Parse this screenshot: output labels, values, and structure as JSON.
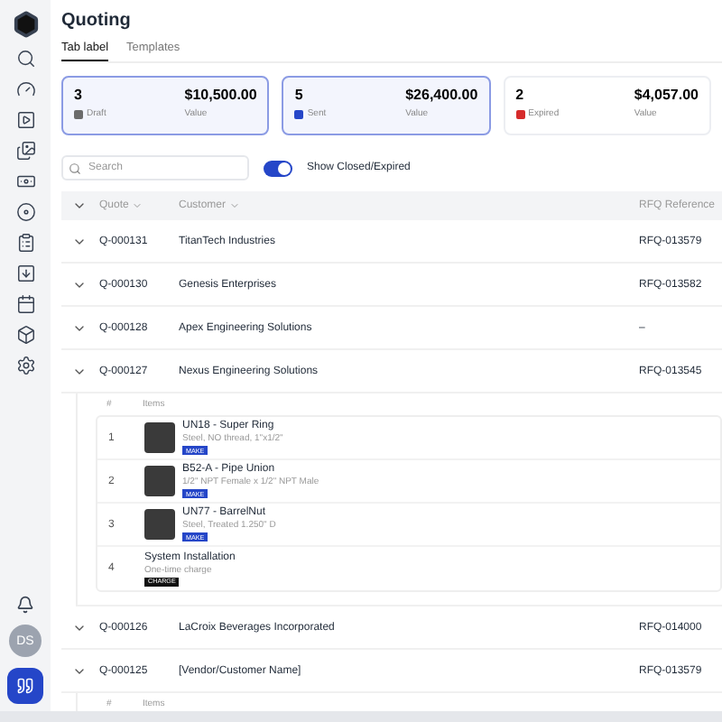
{
  "page": {
    "title": "Quoting"
  },
  "tabs": [
    {
      "label": "Tab label",
      "selected": true
    },
    {
      "label": "Templates",
      "selected": false
    }
  ],
  "cards": [
    {
      "count": "3",
      "status": "Draft",
      "color": "#6b6b6b",
      "amount": "$10,500.00",
      "amount_label": "Value",
      "selected": true
    },
    {
      "count": "5",
      "status": "Sent",
      "color": "#2546c8",
      "amount": "$26,400.00",
      "amount_label": "Value",
      "selected": true
    },
    {
      "count": "2",
      "status": "Expired",
      "color": "#d62b2b",
      "amount": "$4,057.00",
      "amount_label": "Value",
      "selected": false
    }
  ],
  "search": {
    "placeholder": "Search"
  },
  "toggle": {
    "label": "Show Closed/Expired",
    "on": true
  },
  "table": {
    "columns": [
      "Quote",
      "Customer",
      "RFQ Reference"
    ],
    "rows": [
      {
        "quote": "Q-000131",
        "customer": "TitanTech Industries",
        "rfq": "RFQ-013579"
      },
      {
        "quote": "Q-000130",
        "customer": "Genesis Enterprises",
        "rfq": "RFQ-013582"
      },
      {
        "quote": "Q-000128",
        "customer": "Apex Engineering Solutions",
        "rfq": "–"
      },
      {
        "quote": "Q-000127",
        "customer": "Nexus Engineering Solutions",
        "rfq": "RFQ-013545",
        "item_columns": [
          "#",
          "Items"
        ],
        "items": [
          {
            "index": "1",
            "kind": "part",
            "name": "UN18 - Super Ring",
            "desc": "Steel, NO thread, 1\"x1/2\"",
            "tag": "MAKE"
          },
          {
            "index": "2",
            "kind": "part",
            "name": "B52-A - Pipe Union",
            "desc": "1/2\" NPT Female x 1/2\" NPT Male",
            "tag": "MAKE"
          },
          {
            "index": "3",
            "kind": "part",
            "name": "UN77 - BarrelNut",
            "desc": "Steel, Treated 1.250\" D",
            "tag": "MAKE"
          },
          {
            "index": "4",
            "kind": "charge",
            "name": "System Installation",
            "desc": "One-time charge",
            "tag": "CHARGE"
          }
        ]
      },
      {
        "quote": "Q-000126",
        "customer": "LaCroix Beverages Incorporated",
        "rfq": "RFQ-014000"
      },
      {
        "quote": "Q-000125",
        "customer": "[Vendor/Customer Name]",
        "rfq": "RFQ-013579",
        "item_columns": [
          "#",
          "Items"
        ]
      }
    ]
  },
  "user": {
    "initials": "DS"
  }
}
